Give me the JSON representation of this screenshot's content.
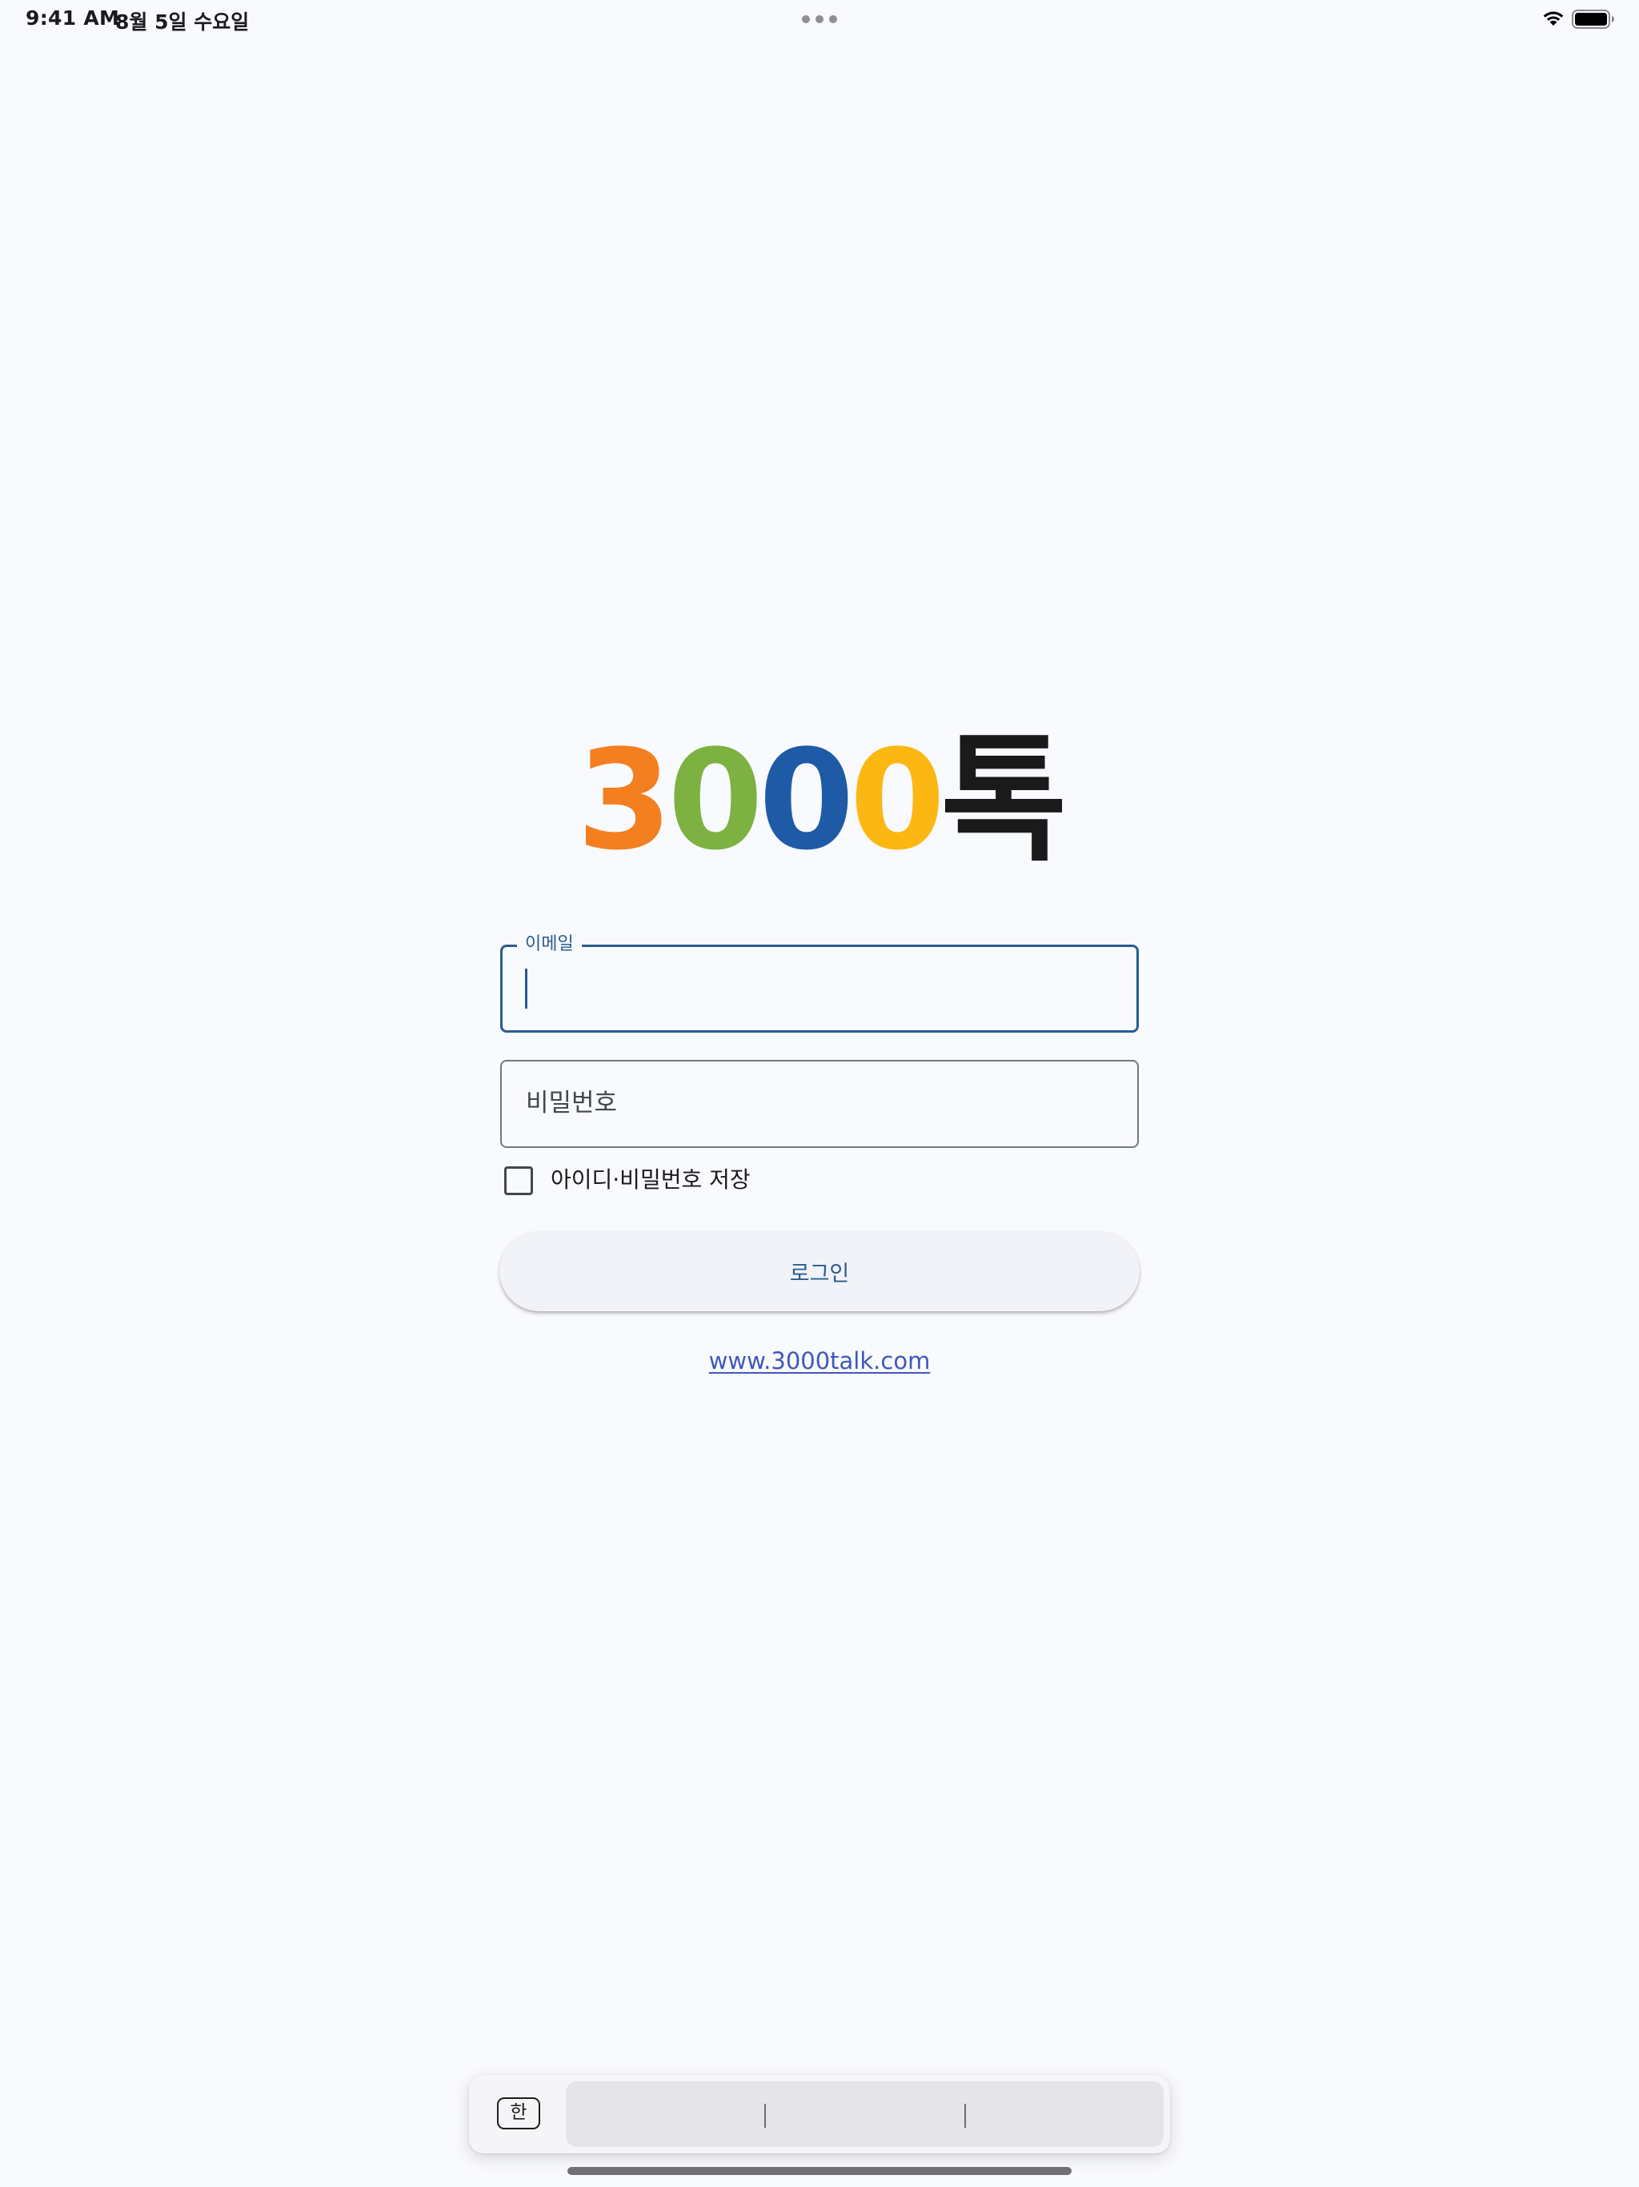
{
  "status_bar": {
    "time": "9:41 AM",
    "date": "8월 5일 수요일"
  },
  "logo": {
    "parts": [
      {
        "text": "3",
        "color": "#f47f20"
      },
      {
        "text": "0",
        "color": "#7db141"
      },
      {
        "text": "0",
        "color": "#1f5aa6"
      },
      {
        "text": "0",
        "color": "#fcb713"
      },
      {
        "text": "톡",
        "color": "#1a1a1a"
      }
    ]
  },
  "login_form": {
    "email_label": "이메일",
    "email_value": "",
    "password_label": "비밀번호",
    "remember_label": "아이디·비밀번호 저장",
    "remember_checked": false,
    "login_button_label": "로그인",
    "website_link": "www.3000talk.com"
  },
  "keyboard_bar": {
    "language_key": "한"
  },
  "colors": {
    "accent": "#2b5c8f",
    "link": "#3f58b8",
    "background": "#f9fafe"
  }
}
